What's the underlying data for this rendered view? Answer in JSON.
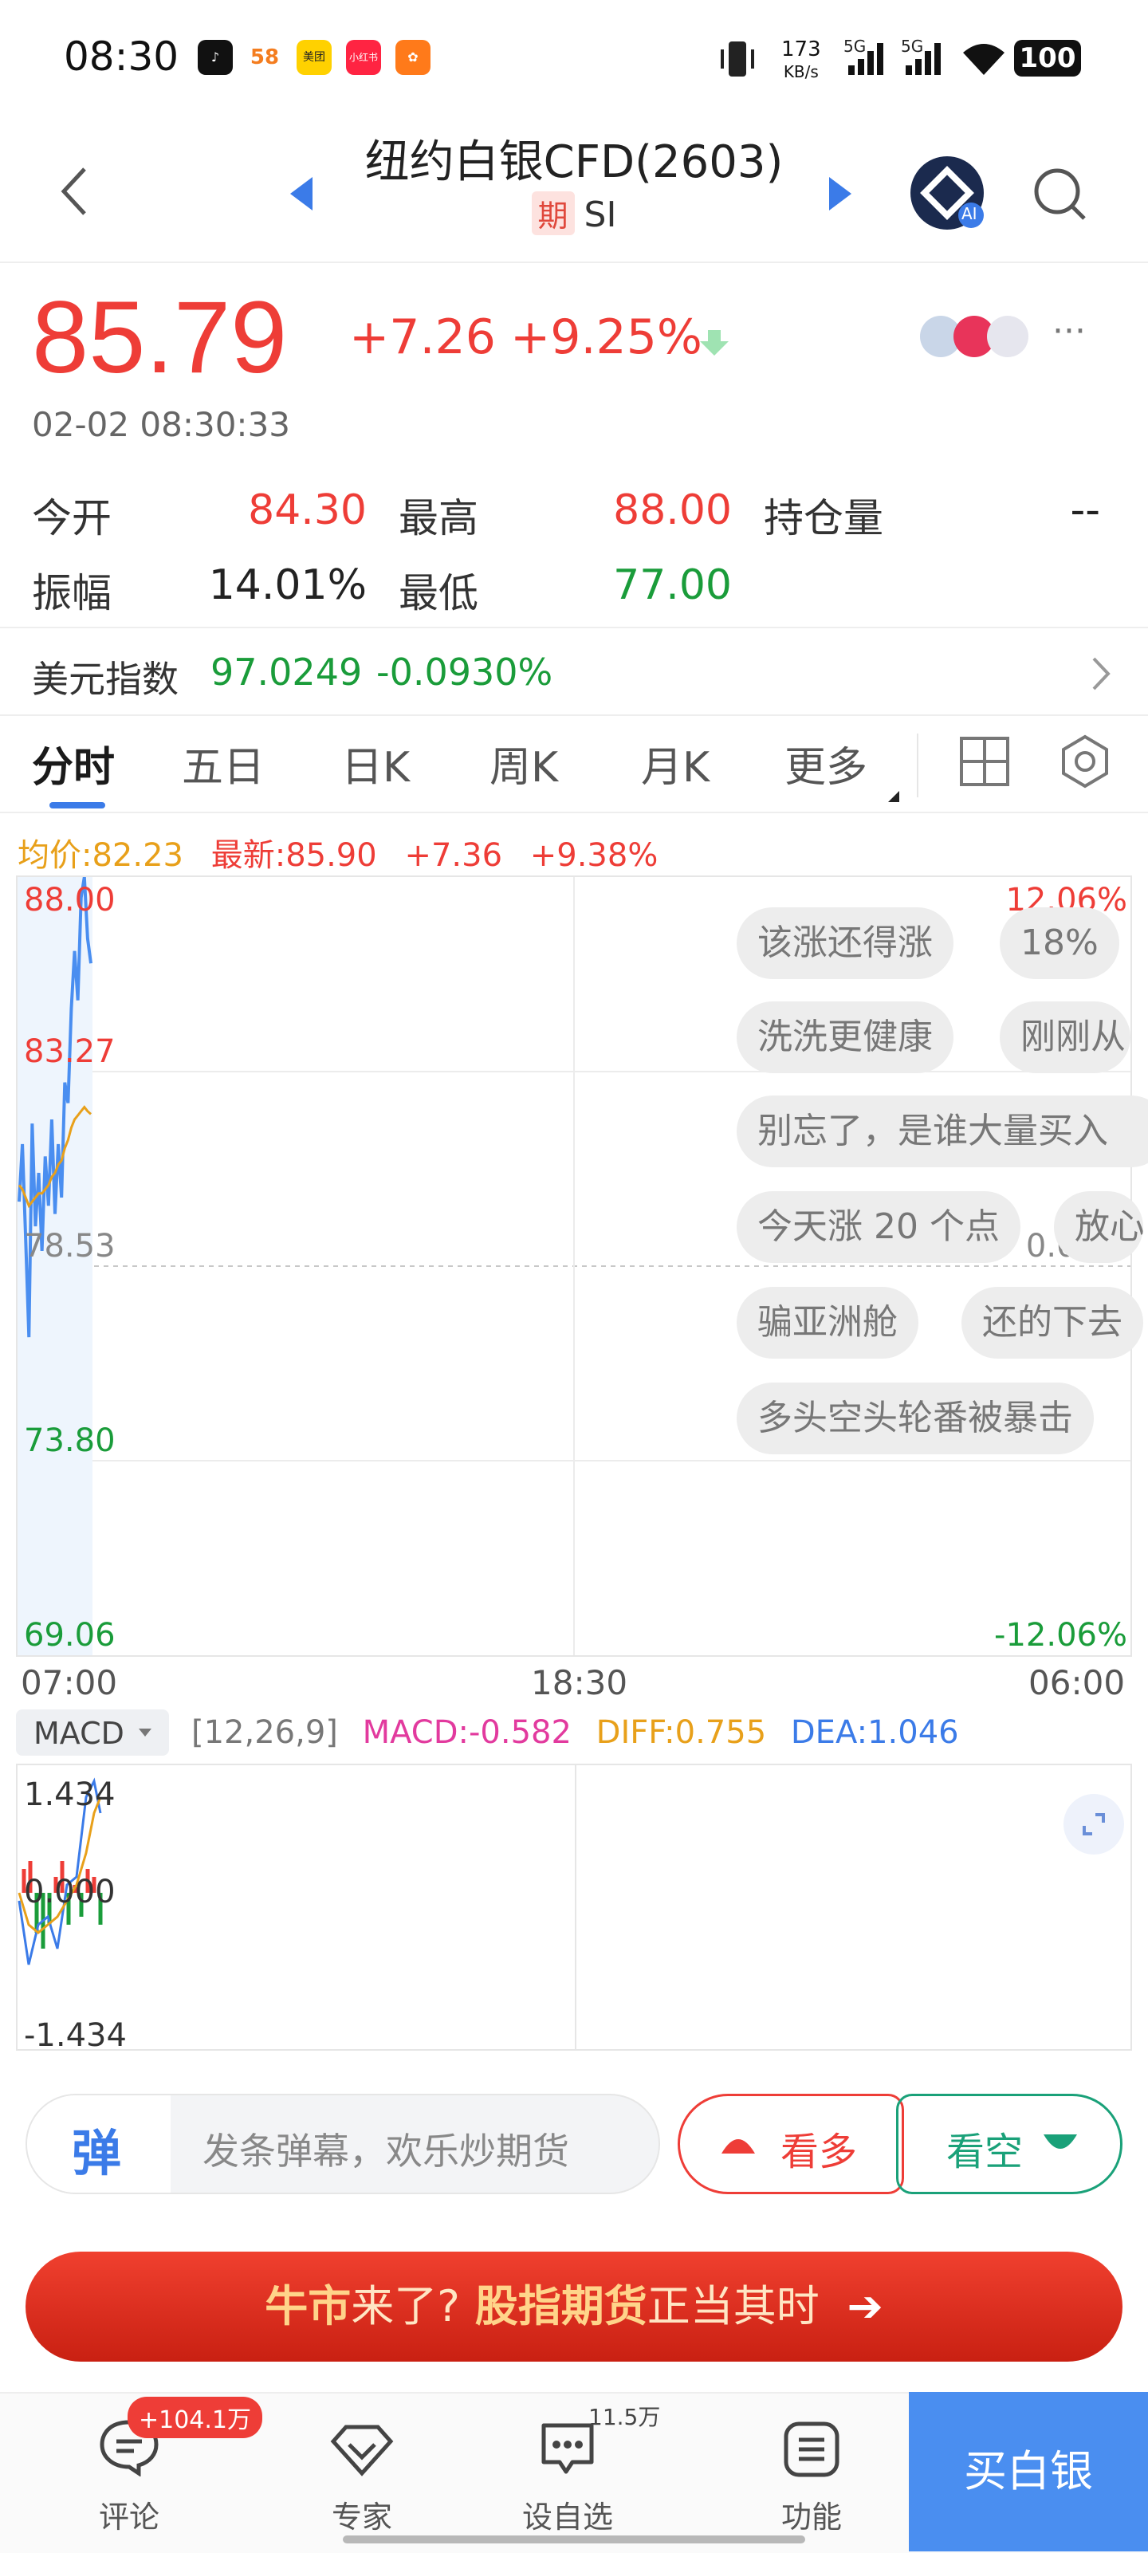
{
  "status_bar": {
    "time": "08:30",
    "net_speed": "173",
    "net_unit": "KB/s",
    "sig1": "5G",
    "sig2": "5G",
    "battery": "100",
    "apps": [
      "tiktok-icon",
      "58-icon",
      "meituan-icon",
      "xiaohongshu-icon",
      "orange-app-icon"
    ],
    "app_labels": {
      "a2": "58",
      "a3": "美团",
      "a4": "小红书"
    }
  },
  "header": {
    "title": "纽约白银CFD(2603)",
    "badge": "期",
    "code": "SI",
    "ai": "AI"
  },
  "quote": {
    "price": "85.79",
    "change": "+7.26",
    "change_pct": "+9.25%",
    "time": "02-02 08:30:33",
    "more": "···"
  },
  "stats": [
    {
      "label": "今开",
      "value": "84.30",
      "color": "red"
    },
    {
      "label": "最高",
      "value": "88.00",
      "color": "red"
    },
    {
      "label": "持仓量",
      "value": "--",
      "color": "dark"
    },
    {
      "label": "振幅",
      "value": "14.01%",
      "color": "dark"
    },
    {
      "label": "最低",
      "value": "77.00",
      "color": "green"
    }
  ],
  "index": {
    "label": "美元指数",
    "value": "97.0249",
    "change": "-0.0930%"
  },
  "tabs": [
    "分时",
    "五日",
    "日K",
    "周K",
    "月K",
    "更多"
  ],
  "chart_info": {
    "avg": "均价:82.23",
    "latest": "最新:85.90",
    "chg": "+7.36",
    "pct": "+9.38%"
  },
  "chart_data": {
    "type": "line",
    "y_labels": [
      "88.00",
      "83.27",
      "78.53",
      "73.80",
      "69.06"
    ],
    "right_labels": [
      "12.06%",
      "0.00%",
      "-12.06%"
    ],
    "x_labels": [
      "07:00",
      "18:30",
      "06:00"
    ],
    "ylim": [
      69.06,
      88.0
    ],
    "series": [
      {
        "values": [
          80.1,
          81.5,
          79.2,
          76.8,
          82.0,
          79.5,
          80.8,
          78.9,
          81.2,
          80.0,
          82.1,
          79.8,
          81.5,
          80.2,
          83.0,
          82.5,
          84.8,
          86.2,
          85.0,
          87.5,
          88.0,
          86.5,
          85.9
        ]
      },
      {
        "values": [
          80.5,
          80.4,
          80.2,
          80.0,
          80.1,
          80.2,
          80.3,
          80.3,
          80.4,
          80.5,
          80.7,
          80.8,
          81.0,
          81.1,
          81.4,
          81.6,
          81.9,
          82.1,
          82.2,
          82.3,
          82.4,
          82.3,
          82.23
        ]
      }
    ]
  },
  "bullets": [
    "该涨还得涨",
    "18%",
    "洗洗更健康",
    "刚刚从",
    "别忘了，是谁大量买入",
    "今天涨 20 个点",
    "放心",
    "骗亚洲舱",
    "还的下去",
    "多头空头轮番被暴击"
  ],
  "macd": {
    "selector": "MACD",
    "params": "[12,26,9]",
    "macd": "MACD:-0.582",
    "diff": "DIFF:0.755",
    "dea": "DEA:1.046",
    "labels": [
      "1.434",
      "0.000",
      "-1.434"
    ]
  },
  "danmu": {
    "icon_text": "弹",
    "placeholder": "发条弹幕，欢乐炒期货",
    "bull": "看多",
    "bear": "看空"
  },
  "banner": {
    "part1": "牛市",
    "part2": "来了?",
    "part3": "股指期货",
    "part4": "正当其时",
    "arrow": "➔"
  },
  "bottom_nav": {
    "comments": "评论",
    "comments_badge": "+104.1万",
    "expert": "专家",
    "watch": "设自选",
    "watch_count": "11.5万",
    "func": "功能",
    "buy": "买白银"
  },
  "colors": {
    "up": "#ee3d37",
    "down": "#1a9c3a",
    "accent": "#3b7be8"
  }
}
